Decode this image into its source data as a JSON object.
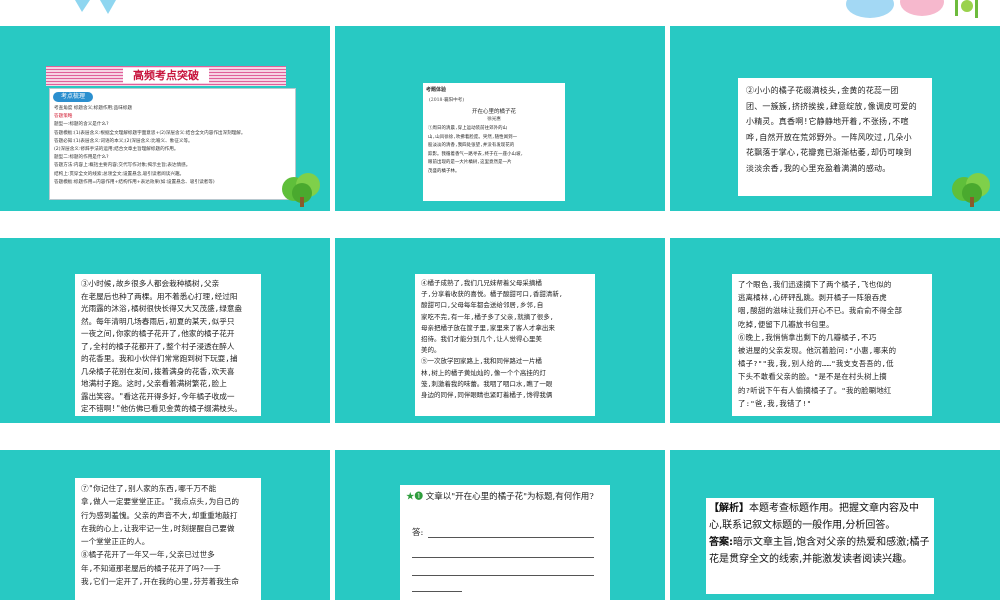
{
  "colors": {
    "slide_bg": "#28c9c3",
    "banner_red": "#c8163e",
    "accent_pink": "#e0609a"
  },
  "slide1": {
    "banner": "高频考点突破",
    "badge": "考点梳理",
    "lines": [
      "考查角度  标题含义;标题作用;品味标题",
      "答题策略",
      "题型一:标题的含义是什么?",
      "答题模板:(1)表层含义:根据全文理解标题字面意思+(2)深层含义:结合全文内容作出深刻理解。",
      "答题必知:(1)表层含义:词语的本义;(2)深层含义:比喻义、象征义等。",
      "(2)深层含义:修辞手法的运用;结合文章主旨理解标题的作用。",
      "题型二:标题的作用是什么?",
      "答题方法:内容上:概括主要内容;交代写作对象;揭示主旨;表达情感。",
      "结构上:贯穿全文的线索;总领全文;设置悬念,吸引读者阅读兴趣。",
      "答题模板:标题作用=内容作用+结构作用+表达效果(如:设置悬念、吸引读者等)"
    ]
  },
  "slide2": {
    "tag": "考题体验",
    "source": "(2018·襄阳中考)",
    "title": "开在心里的橘子花",
    "author": "徐光惠",
    "body": "①周日的清晨,穿上运动装前往郊外的山\n山,山风徐徐,吹拂着脸庞。突然,随性闻到一\n股淡淡的清香,我四处张望,并没有发现花的\n踪影。我循着香气一路寻去,终于在一座小山坡,\n眼前出现的是一大片橘树,这里竟然是一片\n茂盛的橘子林。"
  },
  "slide3": {
    "body": "②小小的橘子花缀满枝头,金黄的花蕊一团\n团、一簇簇,挤挤挨挨,肆意绽放,像调皮可爱的\n小精灵。真香啊!它静静地开着,不张扬,不喧\n哗,自然开放在荒郊野外。一阵风吹过,几朵小\n花飘落于掌心,花瓣竟已渐渐枯萎,却仍可嗅到\n淡淡余香,我的心里充盈着满满的感动。"
  },
  "slide4": {
    "body": "③小时候,故乡很多人都会栽种橘树,父亲\n在老屋后也种了两棵。用不着悉心打理,经过阳\n光雨露的沐浴,橘树很快长得又大又茂盛,绿意盎\n然。每年清明几场春雨后,初夏的某天,似乎只\n一夜之间,你家的橘子花开了,他家的橘子花开\n了,全村的橘子花都开了,整个村子浸透在醉人\n的花香里。我和小伙伴们常常跑到树下玩耍,捕\n几朵橘子花别在发间,拨着满身的花香,欢天喜\n地满村子跑。这时,父亲看着满树繁花,脸上\n露出笑容。\"看这花开得多好,今年橘子收成一\n定不错啊!\"他仿佛已看见金黄的橘子缀满枝头。"
  },
  "slide5": {
    "body": "④橘子成熟了,我们几兄妹帮着父母采摘橘\n子,分享着收获的喜悦。橘子酸甜可口,香甜清新,\n酸甜可口,父母每年都会送给邻居,乡邻,自\n家吃不完,有一年,橘子多了父亲,就摘了很多,\n母亲把橘子放在筐子里,家里来了客人才拿出来\n招待。我们才能分到几个,让人觉得心里美\n美的。\n⑤一次放学回家路上,我和同伴路过一片橘\n林,树上的橘子黄灿灿的,像一个个高挂的灯\n笼,刺激着我的味蕾。我咽了咽口水,瞧了一眼\n身边的同伴,同伴眼睛也紧盯着橘子,馋得我俩"
  },
  "slide6": {
    "body": "了个眼色,我们迅速摘下了两个橘子,飞也似的\n逃离橘林,心砰砰乱跳。剥开橘子一阵狼吞虎\n咽,酸甜的滋味让我们开心不已。我俞俞不得全部\n吃掉,便留下几瓣放书包里。\n⑥晚上,我悄悄拿出剩下的几瓣橘子,不巧\n被进屋的父亲发现。他沉着脸问:\"小惠,哪来的\n橘子?\"\"我,我,别人给的……\"我支支吾吾的,低\n下头不敢看父亲的脸。\"是不是在村头树上摘\n的?听说下午有人偷摘橘子了。\"我的脸唰地红\n了:\"爸,我,我错了!\""
  },
  "slide7": {
    "body": "⑦\"你记住了,别人家的东西,哪千万不能\n拿,做人一定要堂堂正正。\"我点点头,为自己的\n行为感到羞愧。父亲的声音不大,却重重地敲打\n在我的心上,让我牢记一生,时刻提醒自己要做\n一个堂堂正正的人。\n⑧橘子花开了一年又一年,父亲已过世多\n年,不知道那老屋后的橘子花开了吗?——于\n我,它们一定开了,开在我的心里,芬芳着我生命"
  },
  "slide8": {
    "question": "文章以\"开在心里的橘子花\"为标题,有何作用?",
    "answer_label": "答:"
  },
  "slide9": {
    "analysis_label": "【解析】",
    "analysis": "本题考查标题作用。把握文章内容及中心,联系记叙文标题的一般作用,分析回答。",
    "answer_label": "答案:",
    "answer": "暗示文章主旨,饱含对父亲的热爱和感激;橘子花是贯穿全文的线索,并能激发读者阅读兴趣。"
  }
}
